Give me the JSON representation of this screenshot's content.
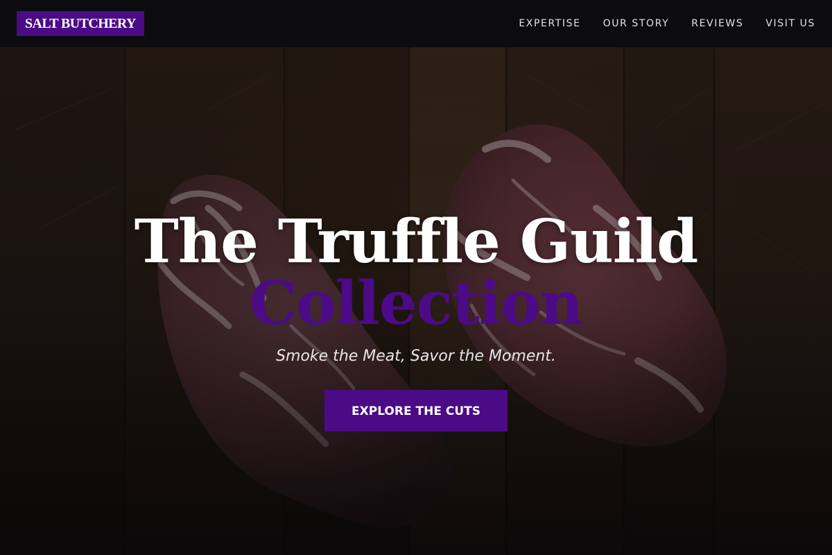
{
  "nav": {
    "logo": "SALT BUTCHERY",
    "links": [
      {
        "label": "EXPERTISE"
      },
      {
        "label": "OUR STORY"
      },
      {
        "label": "REVIEWS"
      },
      {
        "label": "VISIT US"
      }
    ]
  },
  "hero": {
    "title": "The Truffle Guild",
    "title_accent": "Collection",
    "tagline": "Smoke the Meat, Savor the Moment.",
    "cta_label": "EXPLORE THE CUTS"
  },
  "colors": {
    "brand_purple": "#4b0b86",
    "nav_background": "#0c0b0d",
    "text_light": "#ffffff"
  }
}
